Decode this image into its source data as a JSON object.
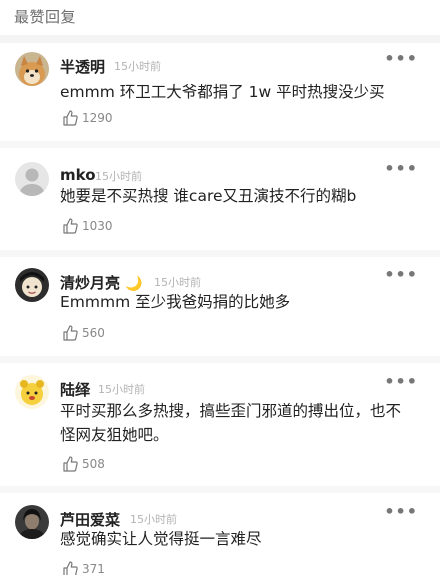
{
  "section_title": "最赞回复",
  "comments": [
    {
      "username": "半透明",
      "timestamp": "15小时前",
      "content_lines": [
        "emmm 环卫工大爷都捐了 1w 平时热搜没少买"
      ],
      "likes": "1290",
      "avatar_icon": "shiba-dog-avatar-icon"
    },
    {
      "username": "mko",
      "timestamp": "15小时前",
      "content_lines": [
        "她要是不买热搜 谁care又丑演技不行的糊b"
      ],
      "likes": "1030",
      "avatar_icon": "default-user-avatar-icon"
    },
    {
      "username": "清炒月亮",
      "moon_emoji": "🌙",
      "timestamp": "15小时前",
      "content_lines": [
        "Emmmm 至少我爸妈捐的比她多"
      ],
      "likes": "560",
      "avatar_icon": "cartoon-character-avatar-icon"
    },
    {
      "username": "陆绎",
      "timestamp": "15小时前",
      "content_lines": [
        "平时买那么多热搜，搞些歪门邪道的搏出位，也不",
        "怪网友狙她吧。"
      ],
      "likes": "508",
      "avatar_icon": "yellow-cartoon-avatar-icon"
    },
    {
      "username": "芦田爱菜",
      "timestamp": "15小时前",
      "content_lines": [
        "感觉确实让人觉得挺一言难尽"
      ],
      "likes": "371",
      "avatar_icon": "dark-photo-avatar-icon"
    }
  ],
  "more_glyph": "•••"
}
